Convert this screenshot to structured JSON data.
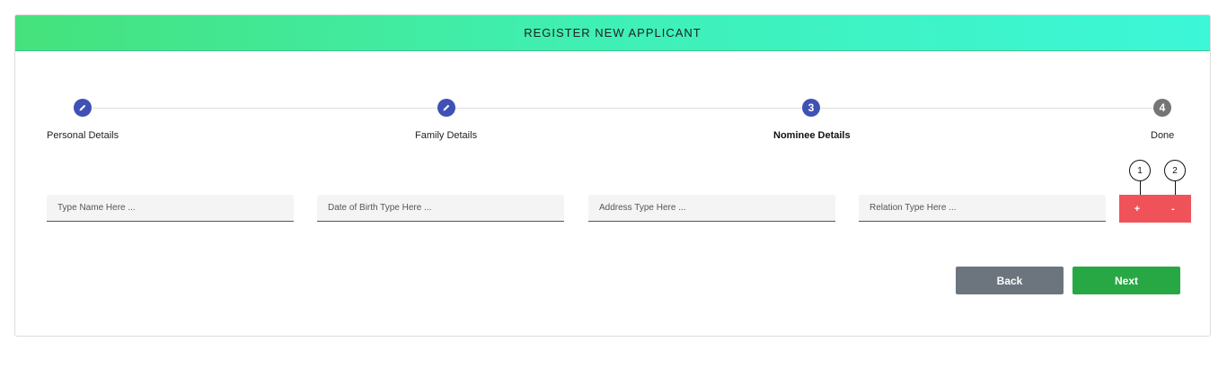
{
  "header": {
    "title": "REGISTER NEW APPLICANT"
  },
  "stepper": {
    "steps": [
      {
        "label": "Personal Details",
        "marker": "",
        "state": "done"
      },
      {
        "label": "Family Details",
        "marker": "",
        "state": "done"
      },
      {
        "label": "Nominee Details",
        "marker": "3",
        "state": "active"
      },
      {
        "label": "Done",
        "marker": "4",
        "state": "pending"
      }
    ]
  },
  "form": {
    "name_placeholder": "Type Name Here ...",
    "dob_placeholder": "Date of Birth Type Here ...",
    "address_placeholder": "Address Type Here ...",
    "relation_placeholder": "Relation Type Here ...",
    "add_label": "+",
    "remove_label": "-"
  },
  "callouts": {
    "one": "1",
    "two": "2"
  },
  "actions": {
    "back_label": "Back",
    "next_label": "Next"
  },
  "colors": {
    "step_done": "#3f51b5",
    "step_pending": "#757575",
    "mini_button": "#f0525a",
    "back": "#6c757d",
    "next": "#28a745"
  }
}
